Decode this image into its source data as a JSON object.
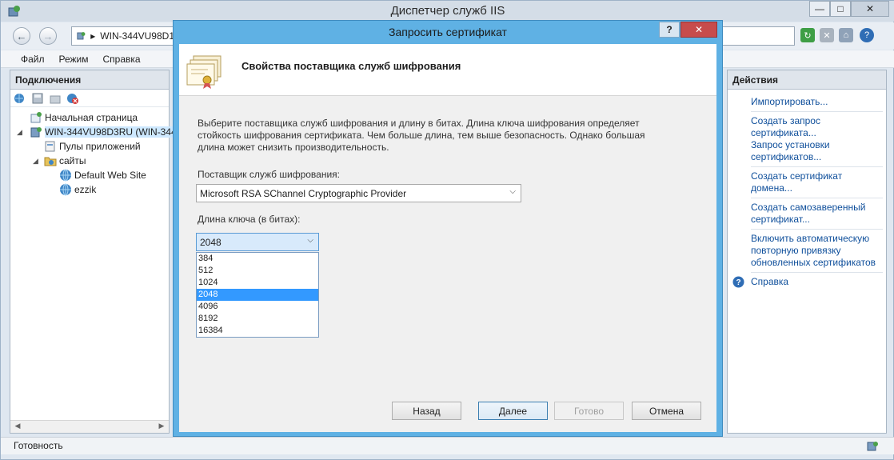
{
  "window": {
    "title": "Диспетчер служб IIS"
  },
  "address": {
    "path": "WIN-344VU98D1"
  },
  "menu": [
    "Файл",
    "Режим",
    "Справка"
  ],
  "connections": {
    "header": "Подключения",
    "tree": [
      {
        "label": "Начальная страница"
      },
      {
        "label": "WIN-344VU98D3RU (WIN-344"
      },
      {
        "label": "Пулы приложений"
      },
      {
        "label": "сайты"
      },
      {
        "label": "Default Web Site"
      },
      {
        "label": "ezzik"
      }
    ]
  },
  "actions": {
    "header": "Действия",
    "items": [
      "Импортировать...",
      "Создать запрос сертификата...",
      "Запрос установки сертификатов...",
      "Создать сертификат домена...",
      "Создать самозаверенный сертификат...",
      "Включить автоматическую повторную привязку обновленных сертификатов",
      "Справка"
    ]
  },
  "status": {
    "text": "Готовность"
  },
  "dialog": {
    "title": "Запросить сертификат",
    "heading": "Свойства поставщика служб шифрования",
    "description": "Выберите поставщика служб шифрования и длину в битах. Длина ключа шифрования определяет стойкость шифрования сертификата. Чем больше длина, тем выше безопасность. Однако большая длина может снизить производительность.",
    "provider_label": "Поставщик служб шифрования:",
    "provider_value": "Microsoft RSA SChannel Cryptographic Provider",
    "keylength_label": "Длина ключа (в битах):",
    "keylength_value": "2048",
    "keylength_options": [
      "384",
      "512",
      "1024",
      "2048",
      "4096",
      "8192",
      "16384"
    ],
    "buttons": {
      "back": "Назад",
      "next": "Далее",
      "finish": "Готово",
      "cancel": "Отмена"
    }
  }
}
